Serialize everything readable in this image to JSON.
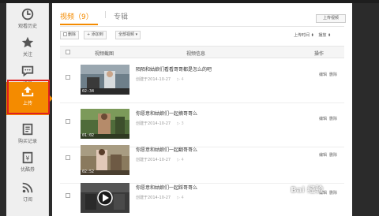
{
  "sidebar": {
    "items": [
      {
        "label": "观看历史",
        "icon": "clock-icon"
      },
      {
        "label": "关注",
        "icon": "star-icon"
      },
      {
        "label": "消息",
        "icon": "chat-icon"
      },
      {
        "label": "上传",
        "icon": "upload-icon",
        "active": true
      },
      {
        "label": "购买记录",
        "icon": "receipt-icon"
      },
      {
        "label": "优酷券",
        "icon": "coupon-icon"
      },
      {
        "label": "订阅",
        "icon": "rss-icon"
      }
    ]
  },
  "tabs": {
    "active": "视频（9）",
    "separator": "|",
    "other": "专辑"
  },
  "upload_button": "上传视频",
  "toolbar": {
    "delete": "删除",
    "add_album": "+ 添加到",
    "all_videos": "全部视频 ▾",
    "sort": "上传时间 ⬍",
    "plays": "播放 ⬍"
  },
  "table": {
    "headers": {
      "thumb": "视频截图",
      "info": "视频信息",
      "ops": "操作"
    },
    "rows": [
      {
        "title": "陌陌和姑娘们看看哥哥都是怎么的吧",
        "date": "创建于2014-10-27",
        "plays": "▷ 4",
        "duration": "02:34",
        "edit": "编辑",
        "delete": "删除"
      },
      {
        "title": "你愿意和姑娘们一起摘哥哥么",
        "date": "创建于2014-10-27",
        "plays": "▷ 3",
        "duration": "01:02",
        "edit": "编辑",
        "delete": "删除"
      },
      {
        "title": "你愿意和姑娘们一起翻哥哥么",
        "date": "创建于2014-10-27",
        "plays": "▷ 4",
        "duration": "02:52",
        "edit": "编辑",
        "delete": "删除"
      },
      {
        "title": "你愿意和姑娘们一起踩哥哥么",
        "date": "创建于2014-10-27",
        "plays": "▷ 4",
        "duration": "",
        "edit": "编辑",
        "delete": "删除"
      }
    ]
  },
  "watermark": "Bai 经验",
  "colors": {
    "accent": "#f48b00",
    "highlight_box": "#e02020"
  }
}
